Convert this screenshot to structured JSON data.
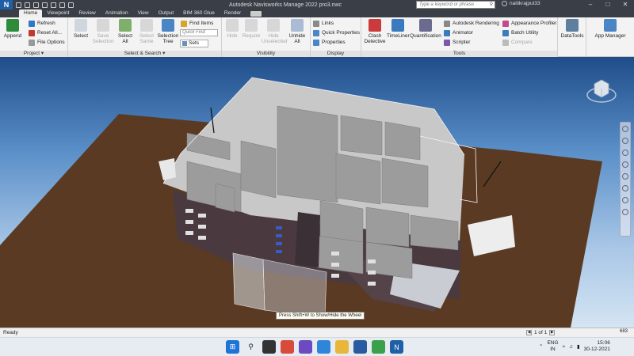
{
  "app": {
    "logo": "N",
    "title": "Autodesk Navisworks Manage 2022    pro3.nwc",
    "search_placeholder": "Type a keyword or phrase",
    "user": "naitikrajput33"
  },
  "tabs": [
    "Home",
    "Viewpoint",
    "Review",
    "Animation",
    "View",
    "Output",
    "BIM 360 Glue",
    "Render"
  ],
  "ribbon": {
    "project": {
      "title": "Project ▾",
      "append": "Append",
      "refresh": "Refresh",
      "reset_all": "Reset All...",
      "file_options": "File Options"
    },
    "select_search": {
      "title": "Select & Search ▾",
      "select": "Select",
      "save_selection": "Save Selection",
      "select_all": "Select All",
      "select_same": "Select Same",
      "selection_tree": "Selection Tree",
      "find_items": "Find Items",
      "quick_find_placeholder": "Quick Find",
      "sets": "Sets"
    },
    "visibility": {
      "title": "Visibility",
      "hide": "Hide",
      "require": "Require",
      "hide_unselected": "Hide Unselected",
      "unhide_all": "Unhide All"
    },
    "display": {
      "title": "Display",
      "links": "Links",
      "quick_properties": "Quick Properties",
      "properties": "Properties"
    },
    "tools": {
      "title": "Tools",
      "clash_detective": "Clash Detective",
      "timeliner": "TimeLiner",
      "quantification": "Quantification",
      "autodesk_rendering": "Autodesk Rendering",
      "animator": "Animator",
      "scripter": "Scripter",
      "appearance_profiler": "Appearance Profiler",
      "batch_utility": "Batch Utility",
      "compare": "Compare"
    },
    "datatools": {
      "label": "DataTools"
    },
    "app_manager": {
      "label": "App Manager"
    }
  },
  "viewport": {
    "hint": "Press Shift+W to Show/Hide the Wheel"
  },
  "status": {
    "left": "Ready",
    "page": "1 of 1",
    "memory": "683"
  },
  "taskbar": {
    "lang_line1": "ENG",
    "lang_line2": "IN",
    "time": "15:06",
    "date": "30-12-2021"
  },
  "colors": {
    "accent": "#1f5fa8",
    "ground": "#5a3a22",
    "wall_exterior": "#4a3a40"
  }
}
